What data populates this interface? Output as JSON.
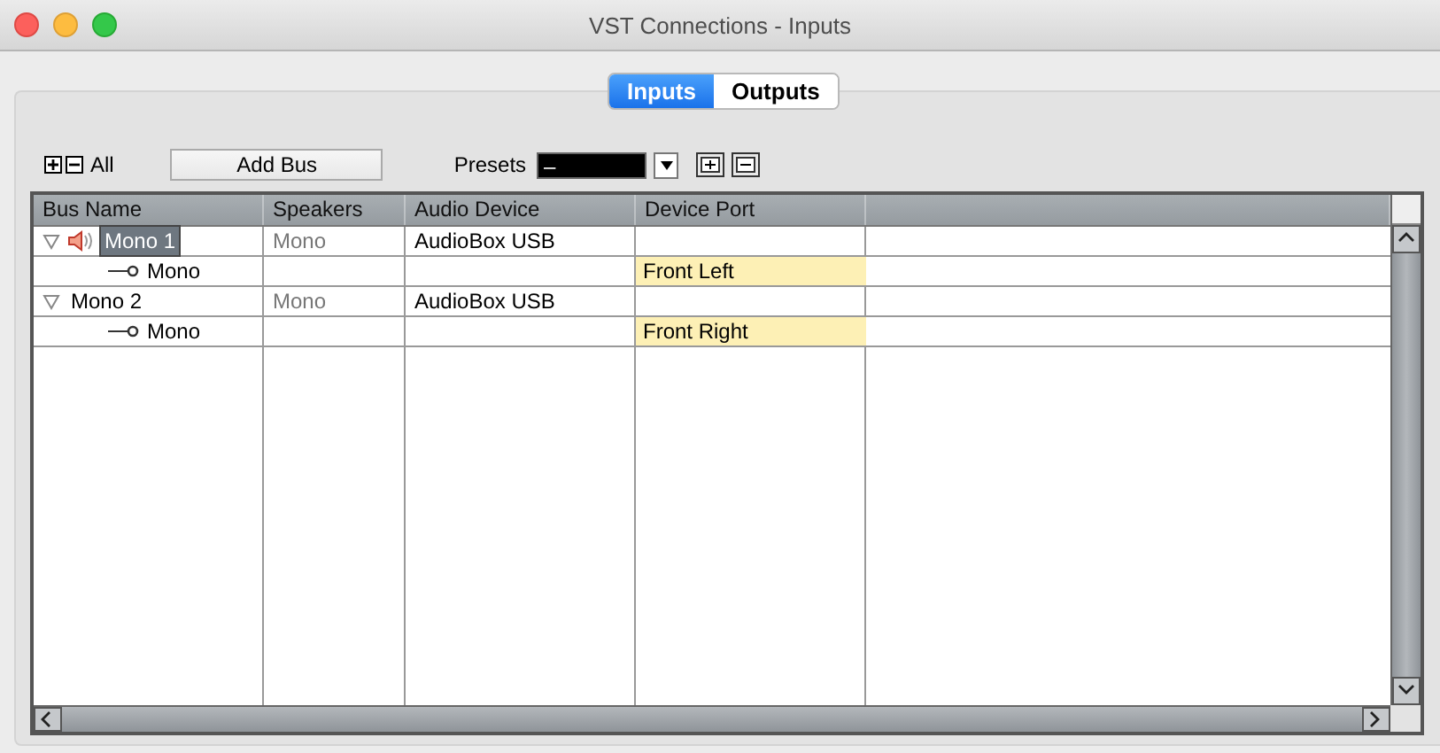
{
  "window": {
    "title": "VST Connections - Inputs"
  },
  "tabs": [
    {
      "label": "Inputs",
      "selected": true
    },
    {
      "label": "Outputs",
      "selected": false
    }
  ],
  "toolbar": {
    "all_label": "All",
    "add_bus": "Add Bus",
    "presets_label": "Presets",
    "preset_value": "–"
  },
  "table": {
    "columns": [
      "Bus Name",
      "Speakers",
      "Audio Device",
      "Device Port"
    ],
    "rows": [
      {
        "kind": "bus",
        "name": "Mono 1",
        "expanded": true,
        "selected": true,
        "speaker_icon": true,
        "speakers": "Mono",
        "device": "AudioBox USB"
      },
      {
        "kind": "channel",
        "name": "Mono",
        "port": "Front Left"
      },
      {
        "kind": "bus",
        "name": "Mono 2",
        "expanded": true,
        "selected": false,
        "speaker_icon": false,
        "speakers": "Mono",
        "device": "AudioBox USB"
      },
      {
        "kind": "channel",
        "name": "Mono",
        "port": "Front Right"
      }
    ]
  }
}
